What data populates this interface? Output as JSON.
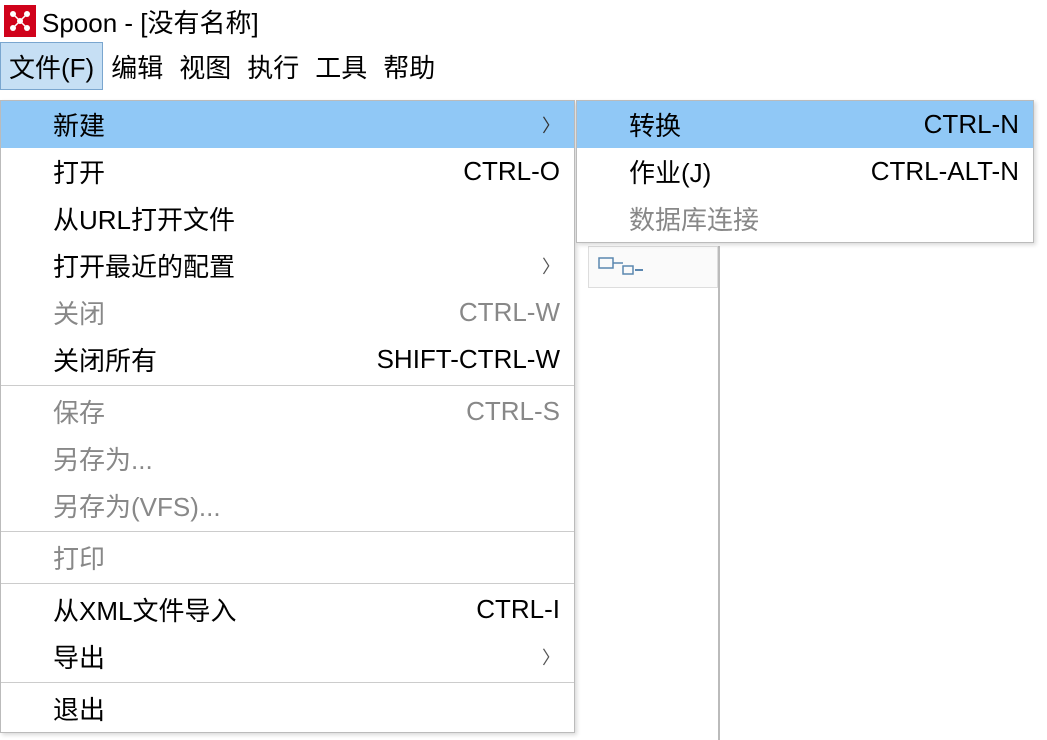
{
  "titlebar": {
    "app_name": "Spoon",
    "doc_title": "[没有名称]"
  },
  "menubar": {
    "file": "文件(F)",
    "edit": "编辑",
    "view": "视图",
    "run": "执行",
    "tools": "工具",
    "help": "帮助"
  },
  "file_menu": {
    "new": "新建",
    "open": "打开",
    "open_shortcut": "CTRL-O",
    "open_url": "从URL打开文件",
    "open_recent": "打开最近的配置",
    "close": "关闭",
    "close_shortcut": "CTRL-W",
    "close_all": "关闭所有",
    "close_all_shortcut": "SHIFT-CTRL-W",
    "save": "保存",
    "save_shortcut": "CTRL-S",
    "save_as": "另存为...",
    "save_as_vfs": "另存为(VFS)...",
    "print": "打印",
    "import_xml": "从XML文件导入",
    "import_xml_shortcut": "CTRL-I",
    "export": "导出",
    "exit": "退出"
  },
  "new_submenu": {
    "transformation": "转换",
    "transformation_shortcut": "CTRL-N",
    "job": "作业(J)",
    "job_shortcut": "CTRL-ALT-N",
    "db_connection": "数据库连接"
  }
}
